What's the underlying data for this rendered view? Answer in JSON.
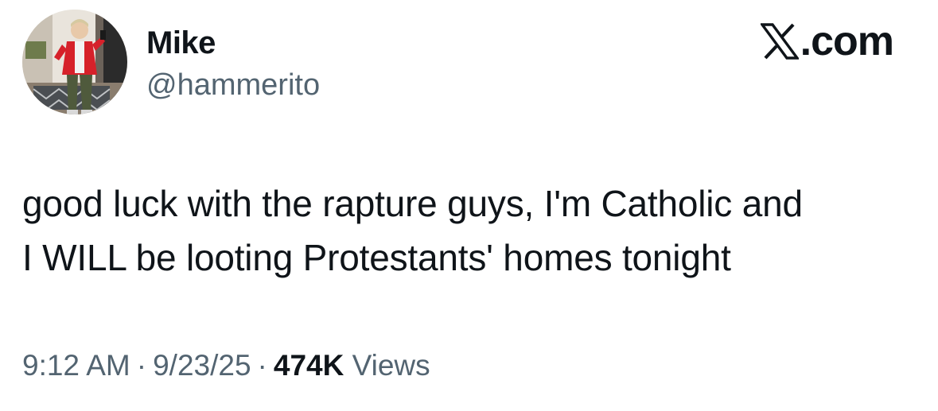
{
  "author": {
    "display_name": "Mike",
    "handle": "@hammerito"
  },
  "brand": {
    "logo_icon": "x-logo-icon",
    "suffix": ".com"
  },
  "tweet": {
    "text_lines": [
      "good luck with the rapture guys, I'm Catholic and",
      "I WILL be looting Protestants' homes tonight"
    ]
  },
  "meta": {
    "time": "9:12 AM",
    "separator": "·",
    "date": "9/23/25",
    "views_count": "474K",
    "views_label": "Views"
  },
  "colors": {
    "text_primary": "#0f1419",
    "text_secondary": "#536471",
    "background": "#ffffff"
  }
}
